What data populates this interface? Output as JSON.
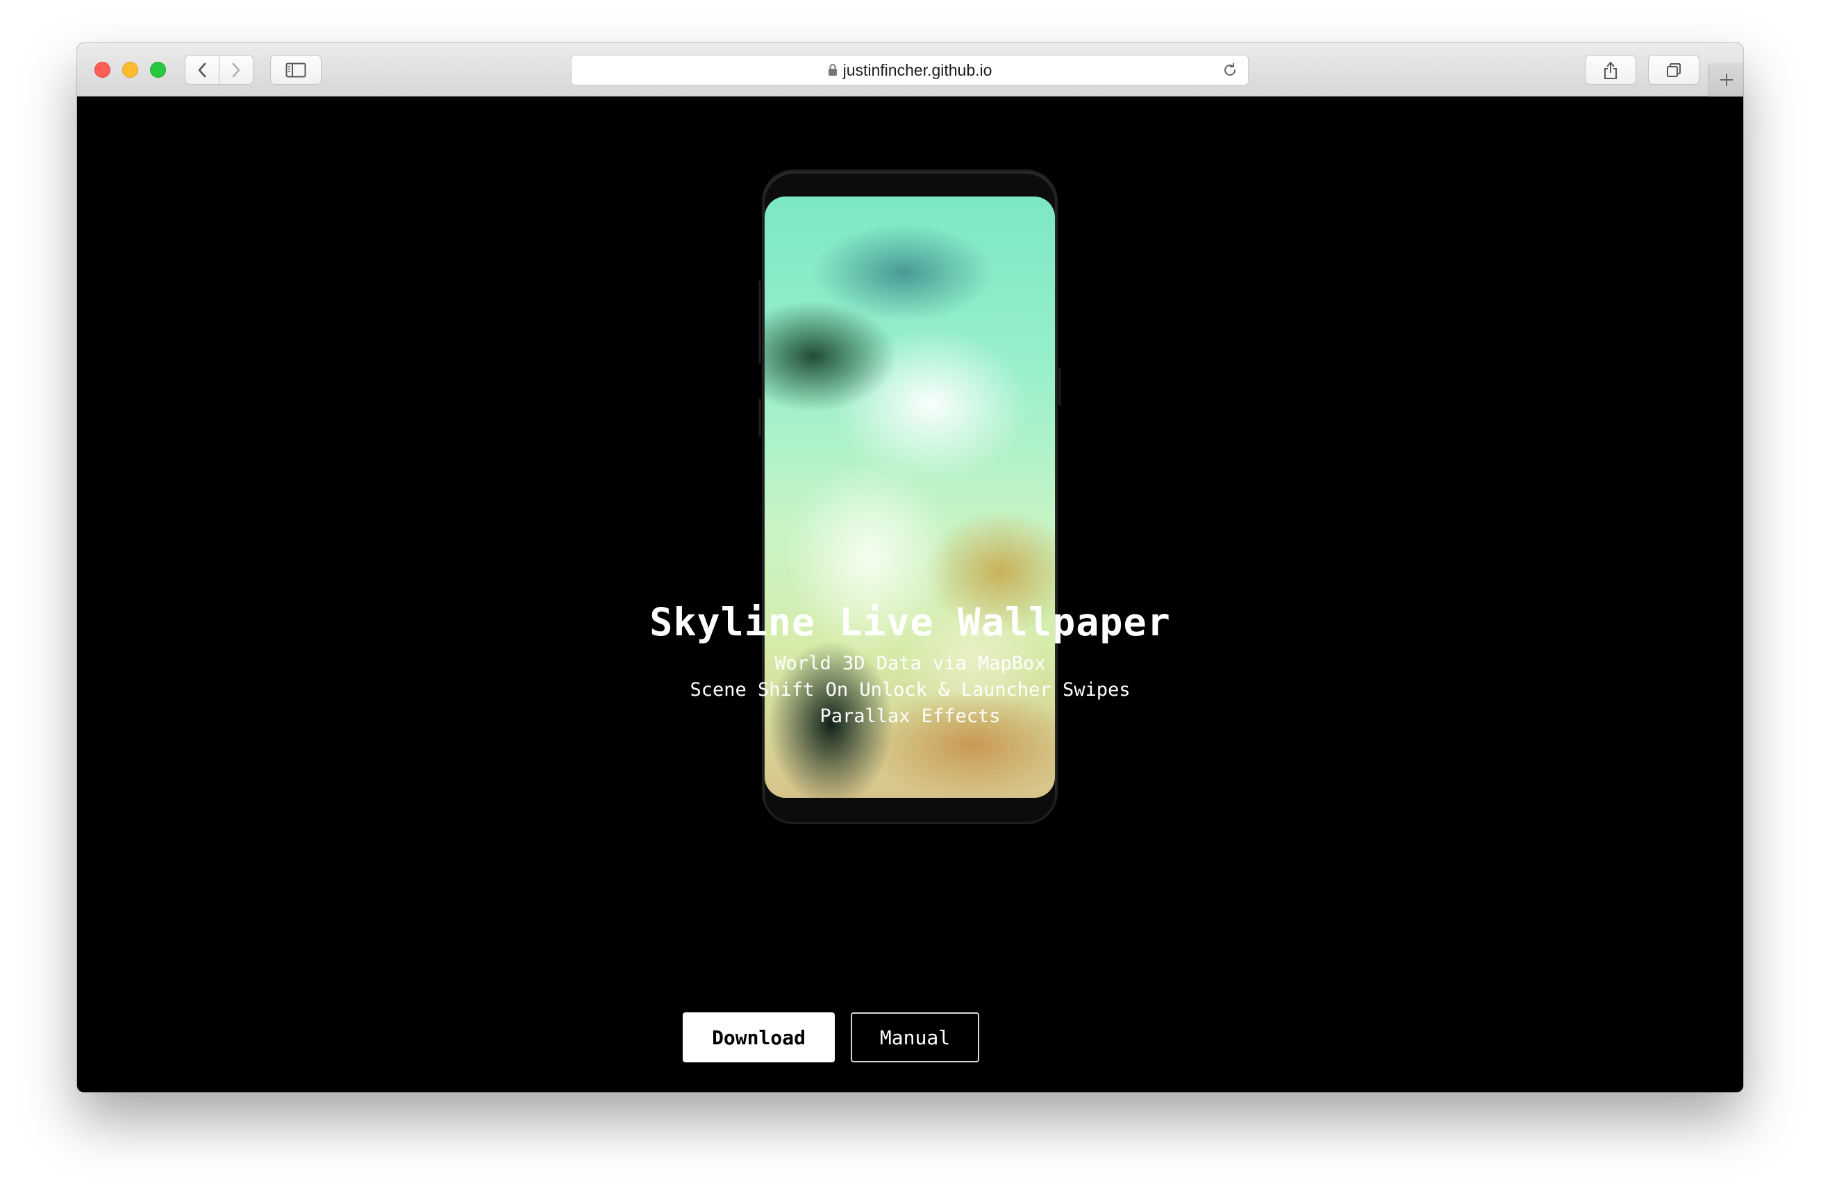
{
  "browser": {
    "url": "justinfincher.github.io",
    "icons": {
      "back": "chevron-left-icon",
      "forward": "chevron-right-icon",
      "sidebar": "sidebar-icon",
      "lock": "lock-icon",
      "reload": "reload-icon",
      "share": "share-icon",
      "tabs": "tabs-overview-icon",
      "new_tab": "plus-icon"
    },
    "traffic_colors": {
      "close": "#fd5f57",
      "minimize": "#febc2e",
      "maximize": "#28c840"
    }
  },
  "page": {
    "background": "#000000",
    "title": "Skyline Live Wallpaper",
    "features": [
      "World 3D Data via MapBox",
      "Scene Shift On Unlock & Launcher Swipes",
      "Parallax Effects"
    ],
    "buttons": {
      "download": "Download",
      "manual": "Manual"
    }
  }
}
